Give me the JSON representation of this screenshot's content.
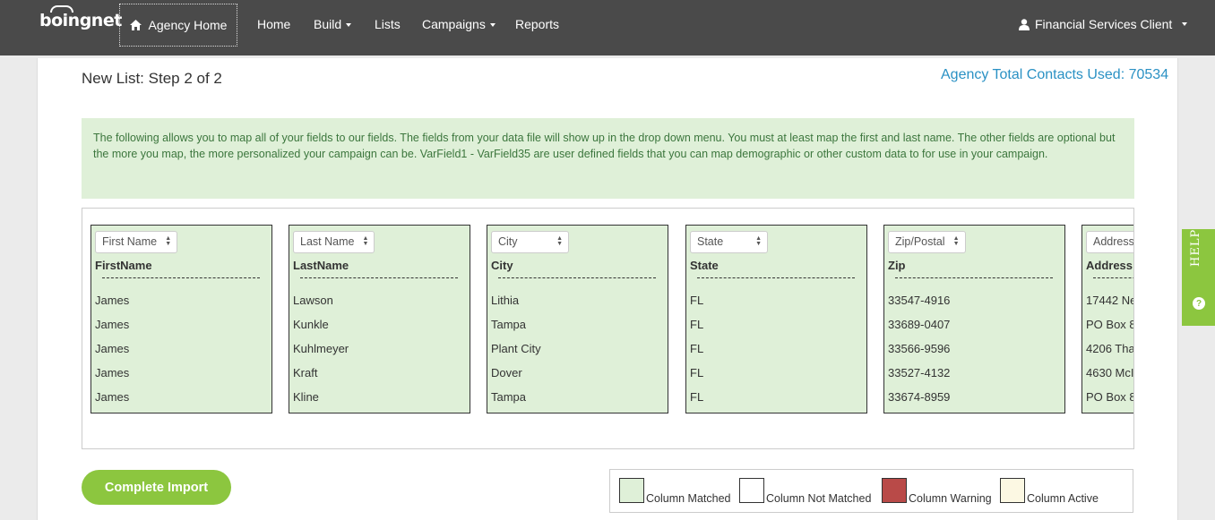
{
  "nav": {
    "logo": "boingnet",
    "agency_home": "Agency Home",
    "items": [
      {
        "label": "Home",
        "caret": false
      },
      {
        "label": "Build",
        "caret": true
      },
      {
        "label": "Lists",
        "caret": false
      },
      {
        "label": "Campaigns",
        "caret": true
      },
      {
        "label": "Reports",
        "caret": false
      }
    ],
    "user": "Financial Services Client"
  },
  "page": {
    "title": "New List: Step 2 of 2",
    "contacts_used": "Agency Total Contacts Used: 70534",
    "info": "The following allows you to map all of your fields to our fields. The fields from your data file will show up in the drop down menu. You must at least map the first and last name. The other fields are optional but the more you map, the more personalized your campaign can be. VarField1 - VarField35 are user defined fields that you can map demographic or other custom data to for use in your campaign."
  },
  "columns": [
    {
      "select": "First Name",
      "header": "FirstName",
      "values": [
        "James",
        "James",
        "James",
        "James",
        "James"
      ]
    },
    {
      "select": "Last Name",
      "header": "LastName",
      "values": [
        "Lawson",
        "Kunkle",
        "Kuhlmeyer",
        "Kraft",
        "Kline"
      ]
    },
    {
      "select": "City",
      "header": "City",
      "values": [
        "Lithia",
        "Tampa",
        "Plant City",
        "Dover",
        "Tampa"
      ]
    },
    {
      "select": "State",
      "header": "State",
      "values": [
        "FL",
        "FL",
        "FL",
        "FL",
        "FL"
      ]
    },
    {
      "select": "Zip/Postal",
      "header": "Zip",
      "values": [
        "33547-4916",
        "33689-0407",
        "33566-9596",
        "33527-4132",
        "33674-8959"
      ]
    },
    {
      "select": "Address",
      "header": "Address",
      "values": [
        "17442 Ne",
        "PO Box 8",
        "4206 Tha",
        "4630 McI",
        "PO Box 8"
      ]
    }
  ],
  "actions": {
    "complete": "Complete Import"
  },
  "legend": [
    {
      "label": "Column Matched",
      "color": "#dff0d8"
    },
    {
      "label": "Column Not Matched",
      "color": "#ffffff"
    },
    {
      "label": "Column Warning",
      "color": "#b94a48"
    },
    {
      "label": "Column Active",
      "color": "#fcf8e3"
    }
  ],
  "help": {
    "label": "HELP"
  },
  "icons": {
    "home": "home-icon",
    "user": "user-icon",
    "help": "question-circle-icon"
  }
}
